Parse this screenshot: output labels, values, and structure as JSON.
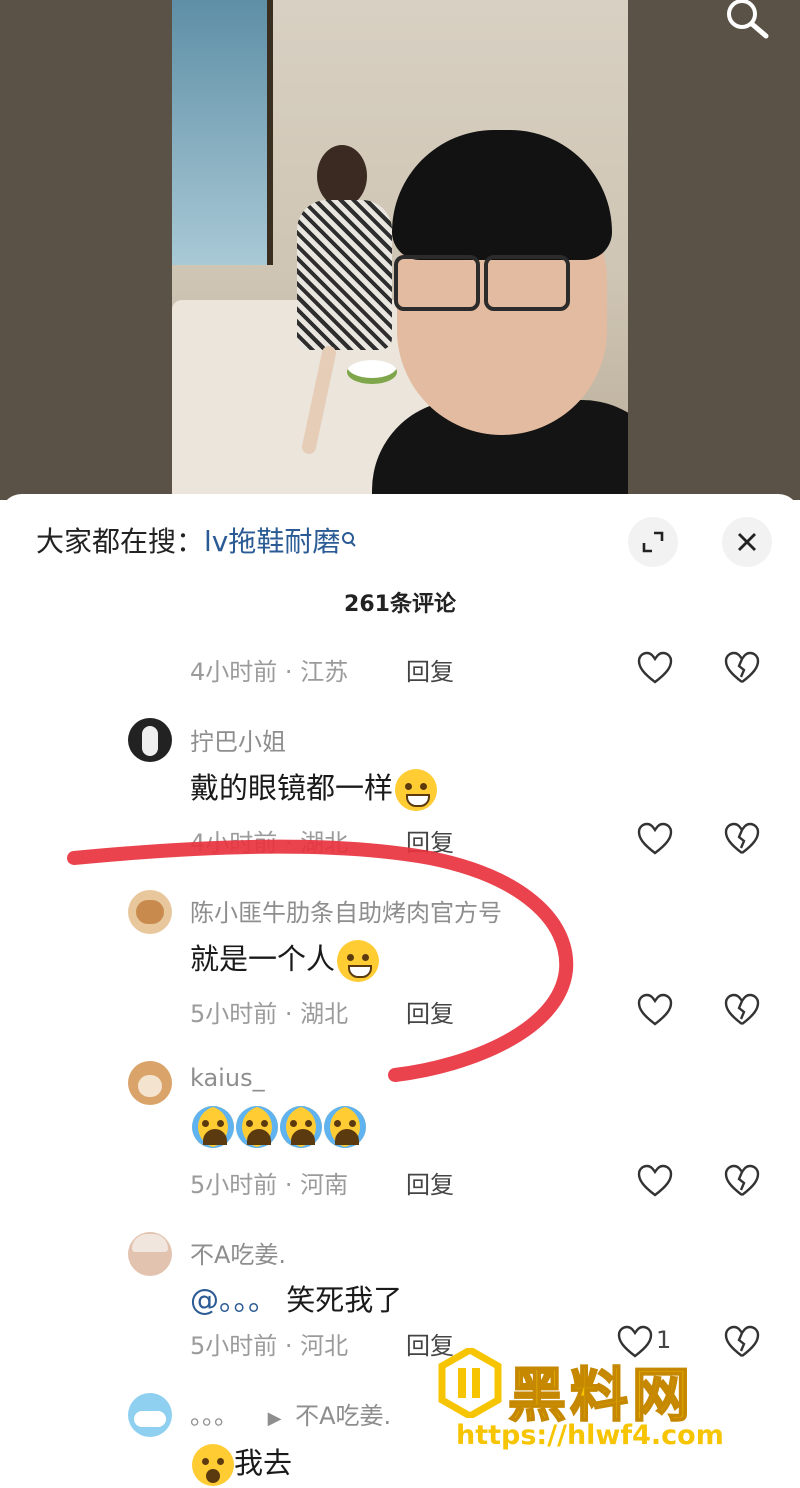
{
  "search_bar": {
    "prefix": "大家都在搜：",
    "keyword": "lv拖鞋耐磨",
    "search_glyph": "ᵔ"
  },
  "comments_header": {
    "count_label": "261条评论"
  },
  "first_meta": {
    "time": "4小时前",
    "sep": "·",
    "location": "江苏",
    "reply": "回复"
  },
  "comments": [
    {
      "username": "拧巴小姐",
      "text": "戴的眼镜都一样",
      "emoji": "sweat-smile",
      "time": "4小时前",
      "location": "湖北",
      "reply": "回复"
    },
    {
      "username": "陈小匪牛肋条自助烤肉官方号",
      "text": "就是一个人",
      "emoji": "grin-sweat",
      "time": "5小时前",
      "location": "湖北",
      "reply": "回复"
    },
    {
      "username": "kaius_",
      "text": "",
      "emoji": "crying-x4",
      "time": "5小时前",
      "location": "河南",
      "reply": "回复"
    },
    {
      "username": "不A吃姜.",
      "mention": "@。。。",
      "text": "笑死我了",
      "time": "5小时前",
      "location": "河北",
      "reply": "回复",
      "likes": "1"
    },
    {
      "username": "。。。",
      "reply_to": "不A吃姜.",
      "text": "我去",
      "emoji": "shocked"
    }
  ],
  "watermark": {
    "brand": "黑料网",
    "url": "https://hlwf4.com"
  },
  "colors": {
    "link": "#2b5b94",
    "annotation": "#e8333e",
    "watermark": "#f6c400"
  }
}
